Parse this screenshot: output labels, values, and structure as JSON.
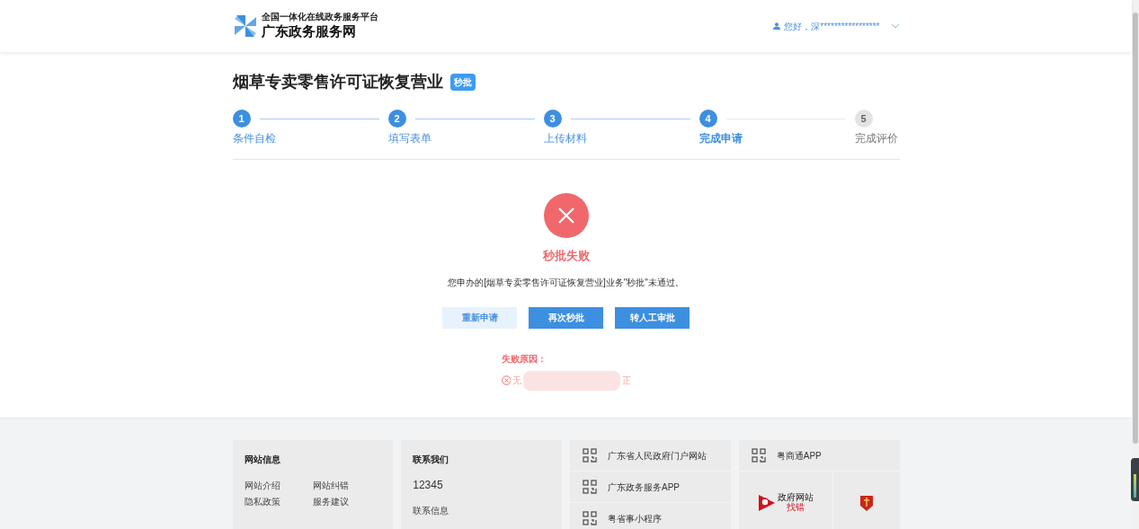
{
  "header": {
    "subtitle": "全国一体化在线政务服务平台",
    "title": "广东政务服务网",
    "user": "您好，深*****************"
  },
  "page": {
    "title": "烟草专卖零售许可证恢复营业",
    "badge": "秒批"
  },
  "steps": [
    {
      "number": "1",
      "label": "条件自检",
      "done": true,
      "selected": false
    },
    {
      "number": "2",
      "label": "填写表单",
      "done": true,
      "selected": false
    },
    {
      "number": "3",
      "label": "上传材料",
      "done": true,
      "selected": false
    },
    {
      "number": "4",
      "label": "完成申请",
      "done": true,
      "selected": true
    },
    {
      "number": "5",
      "label": "完成评价",
      "done": false,
      "selected": false
    }
  ],
  "result": {
    "title": "秒批失败",
    "message": "您申办的[烟草专卖零售许可证恢复营业]业务\"秒批\"未通过。",
    "buttons": [
      {
        "label": "重新申请",
        "kind": "secondary"
      },
      {
        "label": "再次秒批",
        "kind": "primary"
      },
      {
        "label": "转人工审批",
        "kind": "primary"
      }
    ],
    "reason_title": "失败原因：",
    "reason_start": "无",
    "reason_end": "正"
  },
  "footer": {
    "site_info": {
      "title": "网站信息",
      "links": [
        "网站介绍",
        "网站纠错",
        "隐私政策",
        "服务建议"
      ]
    },
    "contact": {
      "title": "联系我们",
      "phone": "12345",
      "link": "联系信息"
    },
    "qr_links": [
      "广东省人民政府门户网站",
      "广东政务服务APP",
      "粤省事小程序"
    ],
    "app": "粤商通APP",
    "logo_texts": [
      "政府网站",
      "找错"
    ]
  }
}
